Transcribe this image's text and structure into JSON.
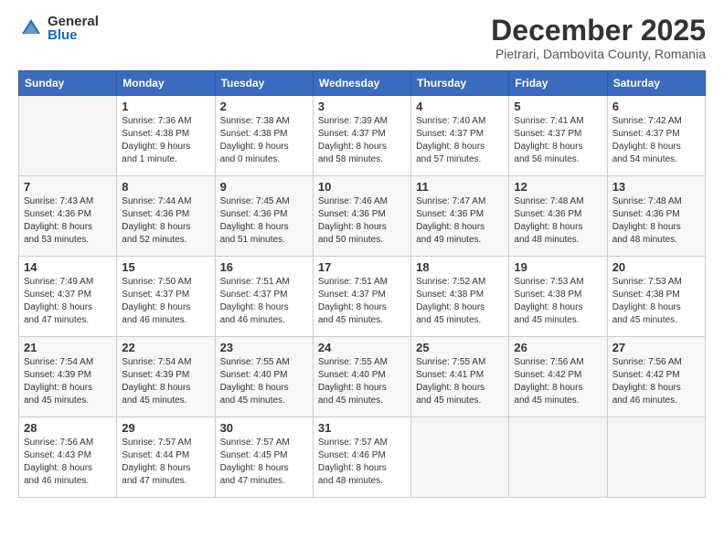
{
  "logo": {
    "general": "General",
    "blue": "Blue"
  },
  "title": "December 2025",
  "subtitle": "Pietrari, Dambovita County, Romania",
  "weekdays": [
    "Sunday",
    "Monday",
    "Tuesday",
    "Wednesday",
    "Thursday",
    "Friday",
    "Saturday"
  ],
  "weeks": [
    [
      {
        "day": "",
        "info": ""
      },
      {
        "day": "1",
        "info": "Sunrise: 7:36 AM\nSunset: 4:38 PM\nDaylight: 9 hours\nand 1 minute."
      },
      {
        "day": "2",
        "info": "Sunrise: 7:38 AM\nSunset: 4:38 PM\nDaylight: 9 hours\nand 0 minutes."
      },
      {
        "day": "3",
        "info": "Sunrise: 7:39 AM\nSunset: 4:37 PM\nDaylight: 8 hours\nand 58 minutes."
      },
      {
        "day": "4",
        "info": "Sunrise: 7:40 AM\nSunset: 4:37 PM\nDaylight: 8 hours\nand 57 minutes."
      },
      {
        "day": "5",
        "info": "Sunrise: 7:41 AM\nSunset: 4:37 PM\nDaylight: 8 hours\nand 56 minutes."
      },
      {
        "day": "6",
        "info": "Sunrise: 7:42 AM\nSunset: 4:37 PM\nDaylight: 8 hours\nand 54 minutes."
      }
    ],
    [
      {
        "day": "7",
        "info": "Sunrise: 7:43 AM\nSunset: 4:36 PM\nDaylight: 8 hours\nand 53 minutes."
      },
      {
        "day": "8",
        "info": "Sunrise: 7:44 AM\nSunset: 4:36 PM\nDaylight: 8 hours\nand 52 minutes."
      },
      {
        "day": "9",
        "info": "Sunrise: 7:45 AM\nSunset: 4:36 PM\nDaylight: 8 hours\nand 51 minutes."
      },
      {
        "day": "10",
        "info": "Sunrise: 7:46 AM\nSunset: 4:36 PM\nDaylight: 8 hours\nand 50 minutes."
      },
      {
        "day": "11",
        "info": "Sunrise: 7:47 AM\nSunset: 4:36 PM\nDaylight: 8 hours\nand 49 minutes."
      },
      {
        "day": "12",
        "info": "Sunrise: 7:48 AM\nSunset: 4:36 PM\nDaylight: 8 hours\nand 48 minutes."
      },
      {
        "day": "13",
        "info": "Sunrise: 7:48 AM\nSunset: 4:36 PM\nDaylight: 8 hours\nand 48 minutes."
      }
    ],
    [
      {
        "day": "14",
        "info": "Sunrise: 7:49 AM\nSunset: 4:37 PM\nDaylight: 8 hours\nand 47 minutes."
      },
      {
        "day": "15",
        "info": "Sunrise: 7:50 AM\nSunset: 4:37 PM\nDaylight: 8 hours\nand 46 minutes."
      },
      {
        "day": "16",
        "info": "Sunrise: 7:51 AM\nSunset: 4:37 PM\nDaylight: 8 hours\nand 46 minutes."
      },
      {
        "day": "17",
        "info": "Sunrise: 7:51 AM\nSunset: 4:37 PM\nDaylight: 8 hours\nand 45 minutes."
      },
      {
        "day": "18",
        "info": "Sunrise: 7:52 AM\nSunset: 4:38 PM\nDaylight: 8 hours\nand 45 minutes."
      },
      {
        "day": "19",
        "info": "Sunrise: 7:53 AM\nSunset: 4:38 PM\nDaylight: 8 hours\nand 45 minutes."
      },
      {
        "day": "20",
        "info": "Sunrise: 7:53 AM\nSunset: 4:38 PM\nDaylight: 8 hours\nand 45 minutes."
      }
    ],
    [
      {
        "day": "21",
        "info": "Sunrise: 7:54 AM\nSunset: 4:39 PM\nDaylight: 8 hours\nand 45 minutes."
      },
      {
        "day": "22",
        "info": "Sunrise: 7:54 AM\nSunset: 4:39 PM\nDaylight: 8 hours\nand 45 minutes."
      },
      {
        "day": "23",
        "info": "Sunrise: 7:55 AM\nSunset: 4:40 PM\nDaylight: 8 hours\nand 45 minutes."
      },
      {
        "day": "24",
        "info": "Sunrise: 7:55 AM\nSunset: 4:40 PM\nDaylight: 8 hours\nand 45 minutes."
      },
      {
        "day": "25",
        "info": "Sunrise: 7:55 AM\nSunset: 4:41 PM\nDaylight: 8 hours\nand 45 minutes."
      },
      {
        "day": "26",
        "info": "Sunrise: 7:56 AM\nSunset: 4:42 PM\nDaylight: 8 hours\nand 45 minutes."
      },
      {
        "day": "27",
        "info": "Sunrise: 7:56 AM\nSunset: 4:42 PM\nDaylight: 8 hours\nand 46 minutes."
      }
    ],
    [
      {
        "day": "28",
        "info": "Sunrise: 7:56 AM\nSunset: 4:43 PM\nDaylight: 8 hours\nand 46 minutes."
      },
      {
        "day": "29",
        "info": "Sunrise: 7:57 AM\nSunset: 4:44 PM\nDaylight: 8 hours\nand 47 minutes."
      },
      {
        "day": "30",
        "info": "Sunrise: 7:57 AM\nSunset: 4:45 PM\nDaylight: 8 hours\nand 47 minutes."
      },
      {
        "day": "31",
        "info": "Sunrise: 7:57 AM\nSunset: 4:46 PM\nDaylight: 8 hours\nand 48 minutes."
      },
      {
        "day": "",
        "info": ""
      },
      {
        "day": "",
        "info": ""
      },
      {
        "day": "",
        "info": ""
      }
    ]
  ]
}
